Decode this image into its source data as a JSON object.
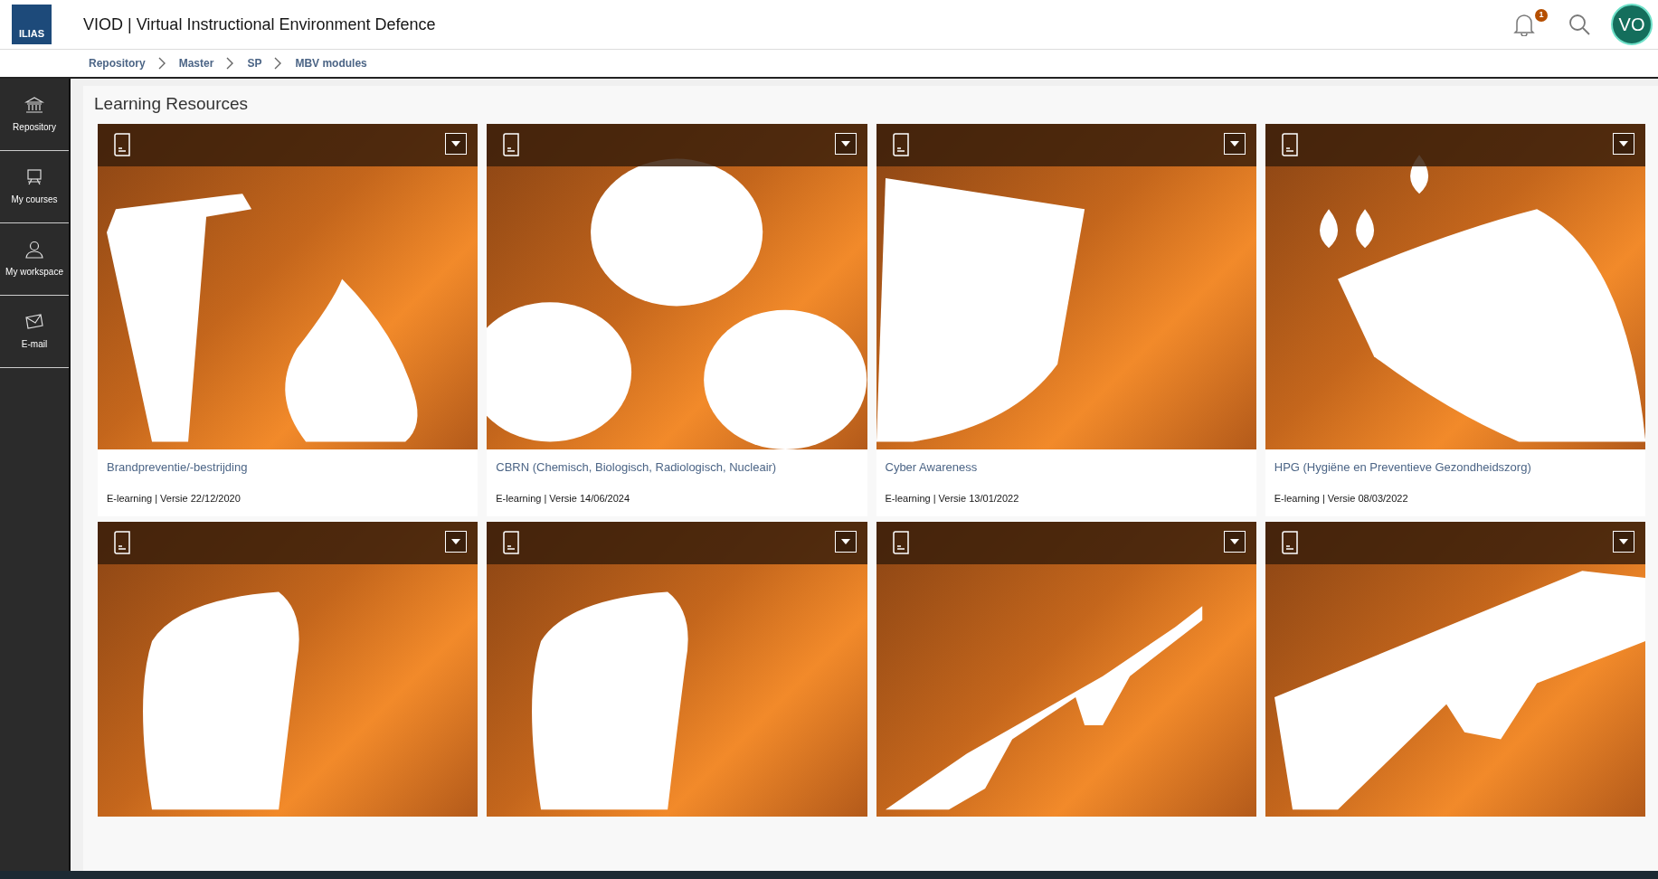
{
  "header": {
    "logo": "ILIAS",
    "title": "VIOD | Virtual Instructional Environment Defence",
    "notification_count": "1",
    "avatar": "VO"
  },
  "breadcrumb": [
    "Repository",
    "Master",
    "SP",
    "MBV modules"
  ],
  "sidebar": {
    "items": [
      {
        "label": "Repository",
        "kind": "bank"
      },
      {
        "label": "My courses",
        "kind": "easel"
      },
      {
        "label": "My workspace",
        "kind": "person"
      },
      {
        "label": "E-mail",
        "kind": "mail"
      }
    ]
  },
  "section_title": "Learning Resources",
  "cards": [
    {
      "kind": "fire",
      "title": "Brandpreventie/-bestrijding",
      "meta": "E-learning | Versie 22/12/2020"
    },
    {
      "kind": "hazard",
      "title": "CBRN (Chemisch, Biologisch, Radiologisch, Nucleair)",
      "meta": "E-learning | Versie 14/06/2024"
    },
    {
      "kind": "shield",
      "title": "Cyber Awareness",
      "meta": "E-learning | Versie 13/01/2022"
    },
    {
      "kind": "hand",
      "title": "HPG (Hygiëne en Preventieve Gezondheidszorg)",
      "meta": "E-learning | Versie 08/03/2022"
    },
    {
      "kind": "helmet"
    },
    {
      "kind": "helmet"
    },
    {
      "kind": "rifle"
    },
    {
      "kind": "pistol"
    }
  ]
}
